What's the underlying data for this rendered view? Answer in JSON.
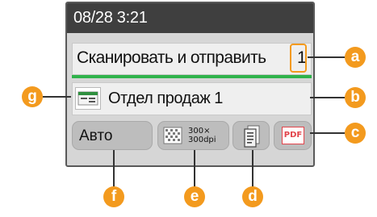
{
  "status": {
    "datetime": "08/28 3:21"
  },
  "job": {
    "title": "Сканировать и отправить",
    "destination_count": "1",
    "destination": "Отдел продаж 1"
  },
  "settings": {
    "color_mode": "Авто",
    "resolution_line1": "300×",
    "resolution_line2": "300dpi",
    "file_format_label": "PDF"
  },
  "callouts": {
    "a": "a",
    "b": "b",
    "c": "c",
    "d": "d",
    "e": "e",
    "f": "f",
    "g": "g"
  },
  "colors": {
    "screen_top_bar": "#3f3f3f",
    "screen_bg": "#d6d6d6",
    "progress_green": "#2fb34b",
    "callout_orange": "#f39a1e",
    "pdf_red": "#e2444b"
  },
  "icons": {
    "destination": "address-book-icon",
    "resolution": "resolution-grid-icon",
    "duplex": "two-sided-document-icon",
    "format": "pdf-icon"
  }
}
